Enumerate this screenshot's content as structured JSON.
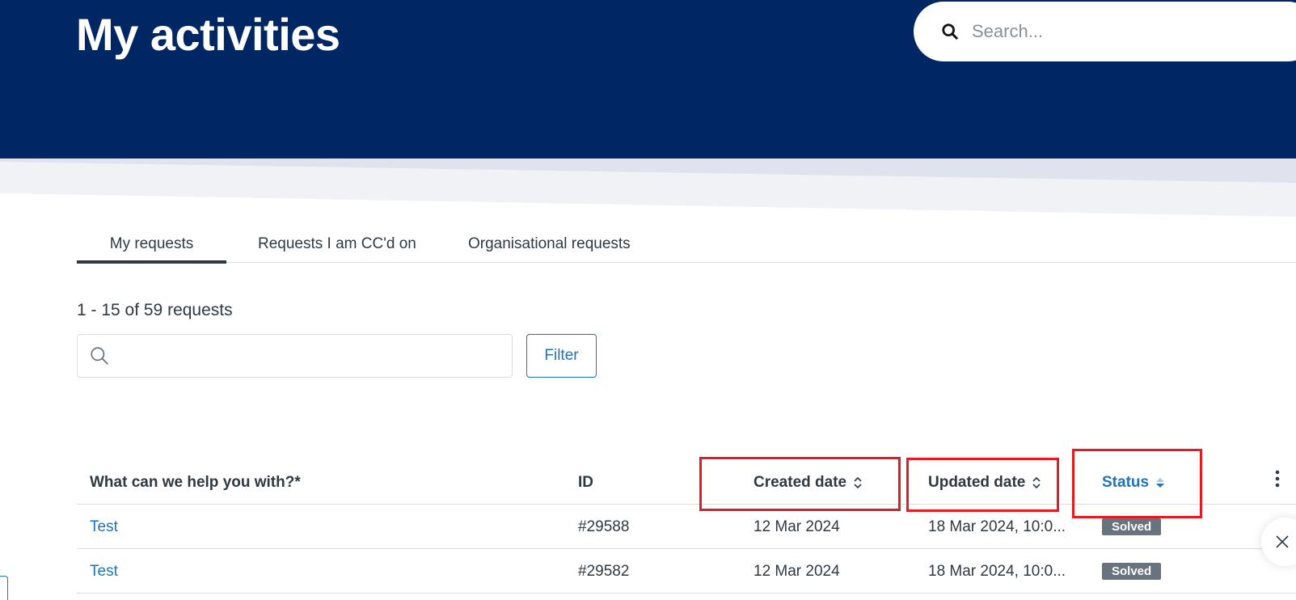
{
  "header": {
    "title": "My activities",
    "search_placeholder": "Search...",
    "colors": {
      "hero_bg": "#002664",
      "accent": "#1f73b7"
    }
  },
  "tabs": [
    {
      "label": "My requests",
      "active": true
    },
    {
      "label": "Requests I am CC'd on",
      "active": false
    },
    {
      "label": "Organisational requests",
      "active": false
    }
  ],
  "requests": {
    "count_label": "1 - 15 of 59 requests",
    "search_value": "",
    "filter_label": "Filter"
  },
  "table": {
    "columns": {
      "subject": "What can we help you with?*",
      "id": "ID",
      "created": "Created date",
      "updated": "Updated date",
      "status": "Status"
    },
    "rows": [
      {
        "subject": "Test",
        "id": "#29588",
        "created": "12 Mar 2024",
        "updated": "18 Mar 2024, 10:0...",
        "status": "Solved"
      },
      {
        "subject": "Test",
        "id": "#29582",
        "created": "12 Mar 2024",
        "updated": "18 Mar 2024, 10:0...",
        "status": "Solved"
      }
    ]
  },
  "icons": {
    "top_search": "search-icon",
    "request_search": "search-icon",
    "sort": "sort-icon",
    "more": "more-vertical-icon",
    "close": "close-icon"
  }
}
